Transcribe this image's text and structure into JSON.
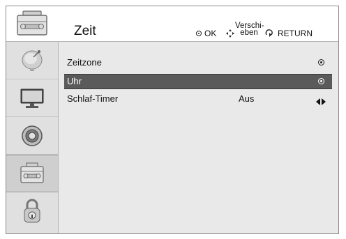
{
  "header": {
    "title": "Zeit",
    "hints": {
      "ok_label": "OK",
      "move_label_line1": "Verschi-",
      "move_label_line2": "eben",
      "return_label": "RETURN"
    }
  },
  "sidebar": {
    "items": [
      {
        "name": "satellite-dish-icon",
        "active": false
      },
      {
        "name": "monitor-icon",
        "active": false
      },
      {
        "name": "speaker-icon",
        "active": false
      },
      {
        "name": "toolbox-icon",
        "active": true
      },
      {
        "name": "lock-icon",
        "active": false
      }
    ]
  },
  "menu": {
    "items": [
      {
        "label": "Zeitzone",
        "value": "",
        "control": "radio-icon",
        "selected": false
      },
      {
        "label": "Uhr",
        "value": "",
        "control": "radio-icon",
        "selected": true
      },
      {
        "label": "Schlaf-Timer",
        "value": "Aus",
        "control": "left-right-arrows-icon",
        "selected": false
      }
    ]
  },
  "colors": {
    "selected_row": "#5a5a5a",
    "content_bg": "#e9e9e9",
    "sidebar_bg": "#e0e0e0"
  }
}
